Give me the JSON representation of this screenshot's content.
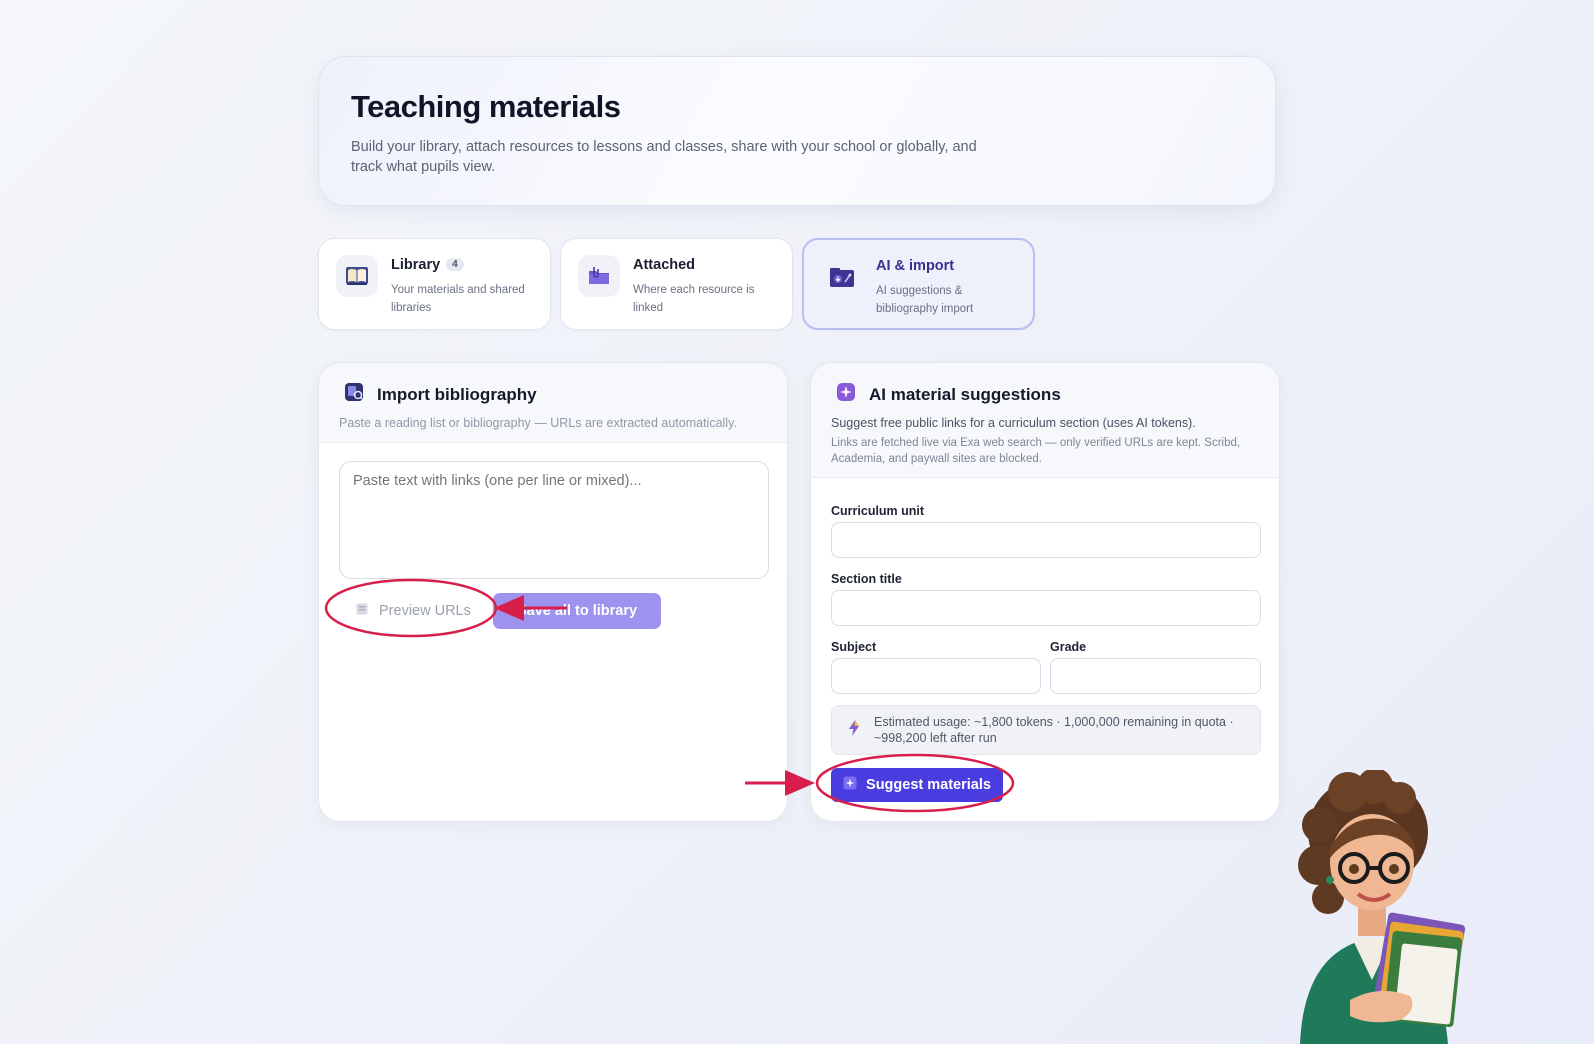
{
  "header": {
    "title": "Teaching materials",
    "subtitle": "Build your library, attach resources to lessons and classes, share with your school or globally, and track what pupils view."
  },
  "tabs": [
    {
      "label": "Library",
      "badge": "4",
      "desc": "Your materials and shared libraries",
      "icon": "book-icon"
    },
    {
      "label": "Attached",
      "desc": "Where each resource is linked",
      "icon": "folder-icon"
    },
    {
      "label": "AI & import",
      "desc": "AI suggestions & bibliography import",
      "icon": "ai-import-icon",
      "active": true
    }
  ],
  "import_panel": {
    "title": "Import bibliography",
    "description": "Paste a reading list or bibliography — URLs are extracted automatically.",
    "textarea_placeholder": "Paste text with links (one per line or mixed)...",
    "preview_label": "Preview URLs",
    "save_label": "Save all to library"
  },
  "ai_panel": {
    "title": "AI material suggestions",
    "description": "Suggest free public links for a curriculum section (uses AI tokens).",
    "note": "Links are fetched live via Exa web search — only verified URLs are kept. Scribd, Academia, and paywall sites are blocked.",
    "fields": {
      "curriculum_unit": "Curriculum unit",
      "section_title": "Section title",
      "subject": "Subject",
      "grade": "Grade"
    },
    "usage": "Estimated usage: ~1,800 tokens · 1,000,000 remaining in quota · ~998,200 left after run",
    "suggest_label": "Suggest materials"
  },
  "colors": {
    "accent": "#4a3de0",
    "accent_light": "#9d93ef",
    "annotation": "#d81e4a"
  }
}
